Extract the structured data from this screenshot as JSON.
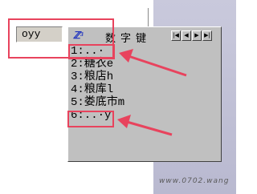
{
  "input_box": {
    "value": "oyy"
  },
  "ime_panel": {
    "logo_icon": "shuang-pin-logo-icon",
    "title": "数字键",
    "nav_buttons": [
      {
        "icon": "first-page-icon",
        "glyph": "|◀"
      },
      {
        "icon": "prev-page-icon",
        "glyph": "◀"
      },
      {
        "icon": "next-page-icon",
        "glyph": "▶"
      },
      {
        "icon": "last-page-icon",
        "glyph": "▶|"
      }
    ],
    "candidates": [
      "1:..·",
      "2:糖衣e",
      "3:粮店h",
      "4:粮库l",
      "5:娄底市m",
      "6:..·y"
    ]
  },
  "annotation_color": "#e8435d",
  "watermark": "www.0702.wang"
}
